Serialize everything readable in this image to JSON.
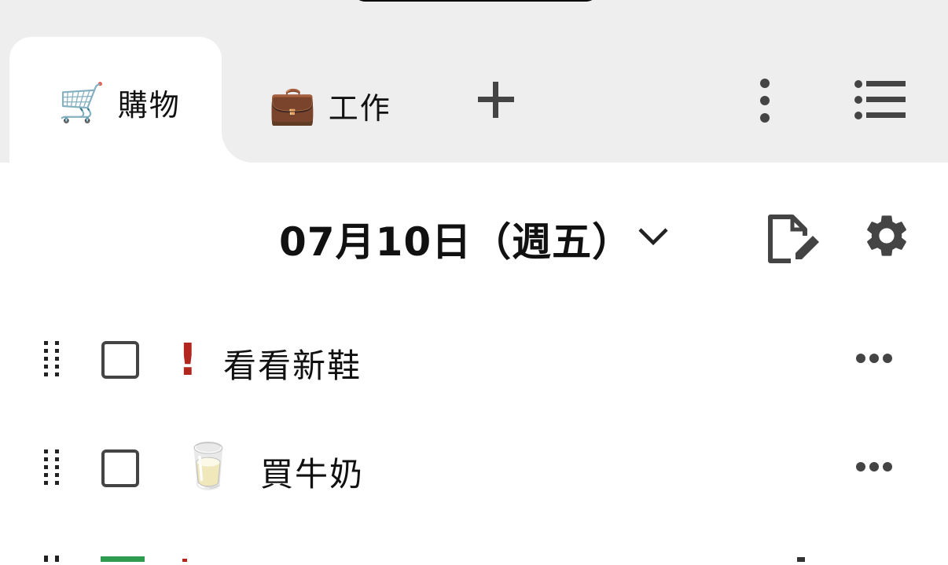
{
  "tabs": [
    {
      "label": "購物",
      "icon": "shopping-cart-icon",
      "emoji": "🛒",
      "active": true
    },
    {
      "label": "工作",
      "icon": "briefcase-icon",
      "emoji": "💼",
      "active": false
    }
  ],
  "header": {
    "date_title": "07月10日（週五）"
  },
  "todos": [
    {
      "text": "看看新鞋",
      "priority_mark": "!",
      "emoji": "",
      "checked": false
    },
    {
      "text": "買牛奶",
      "priority_mark": "",
      "emoji": "🥛",
      "checked": false
    }
  ],
  "colors": {
    "priority": "#b3261e",
    "topbar_bg": "#eeeeee",
    "icon_gray": "#444444",
    "checked_green": "#2e9d4f"
  }
}
